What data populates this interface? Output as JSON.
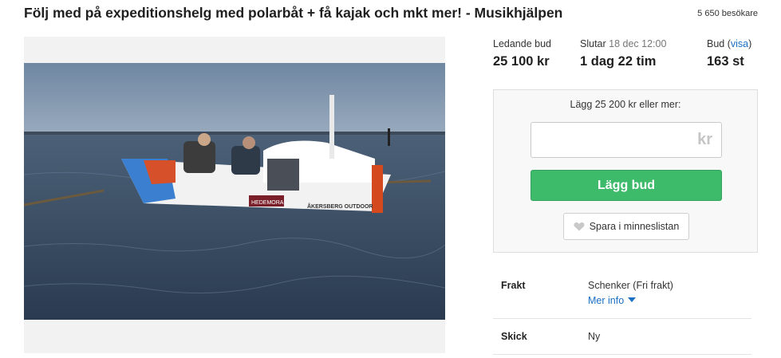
{
  "listing": {
    "title": "Följ med på expeditionshelg med polarbåt + få kajak och mkt mer! - Musikhjälpen",
    "visitors": "5 650 besökare"
  },
  "image": {
    "alt": "Rowing boat with two people on grey sea",
    "boat_labels": [
      "HEDEMORA",
      "ÅKERSBERG OUTDOOR"
    ]
  },
  "stats": {
    "leading_bid_label": "Ledande bud",
    "leading_bid_value": "25 100 kr",
    "ends_label": "Slutar",
    "ends_date": "18 dec 12:00",
    "ends_value": "1 dag 22 tim",
    "bids_label": "Bud",
    "bids_link": "visa",
    "bids_value": "163 st"
  },
  "bid": {
    "hint": "Lägg 25 200 kr eller mer:",
    "input_value": "",
    "currency_suffix": "kr",
    "submit_label": "Lägg bud",
    "save_label": "Spara i minneslistan",
    "save_icon": "heart-icon"
  },
  "details": {
    "shipping_label": "Frakt",
    "shipping_value": "Schenker (Fri frakt)",
    "more_info": "Mer info",
    "condition_label": "Skick",
    "condition_value": "Ny"
  },
  "colors": {
    "bid_button": "#3dba6a",
    "link": "#1a6fc4",
    "sea": "#3b4f66",
    "sky": "#7d93ad"
  }
}
